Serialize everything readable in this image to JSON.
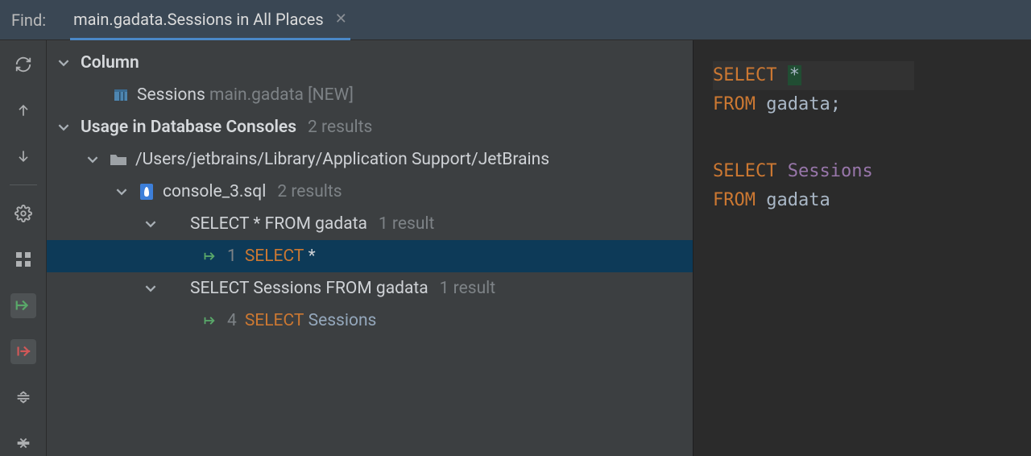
{
  "findbar": {
    "label": "Find:",
    "tab": "main.gadata.Sessions in All Places"
  },
  "tree": {
    "column_header": "Column",
    "column_item_name": "Sessions",
    "column_item_schema": "main.gadata",
    "column_item_badge": "[NEW]",
    "consoles_header": "Usage in Database Consoles",
    "consoles_count": "2 results",
    "folder_path": "/Users/jetbrains/Library/Application Support/JetBrains",
    "file_name": "console_3.sql",
    "file_count": "2 results",
    "q1_text": "SELECT * FROM gadata",
    "q1_count": "1 result",
    "hit1_line": "1",
    "hit1_kw": "SELECT",
    "hit1_rest": "*",
    "q2_text": "SELECT Sessions FROM gadata",
    "q2_count": "1 result",
    "hit2_line": "4",
    "hit2_kw": "SELECT",
    "hit2_rest": "Sessions"
  },
  "preview": {
    "l1_kw": "SELECT",
    "l1_star": "*",
    "l2_kw": "FROM",
    "l2_id": "gadata;",
    "l3_kw": "SELECT",
    "l3_col": "Sessions",
    "l4_kw": "FROM",
    "l4_id": "gadata"
  }
}
